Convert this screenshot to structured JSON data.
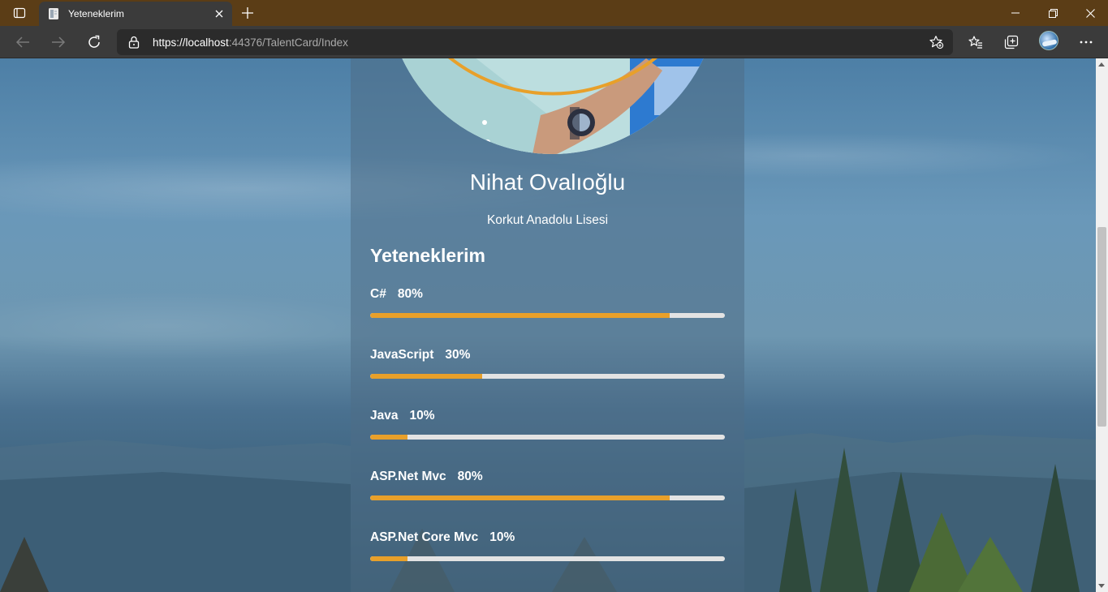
{
  "browser": {
    "tab_title": "Yeteneklerim",
    "url_host": "https://localhost",
    "url_rest": ":44376/TalentCard/Index",
    "icons": [
      "tab-actions-icon",
      "page-favicon-icon",
      "close-icon",
      "plus-icon",
      "minimize-icon",
      "restore-icon",
      "close-window-icon",
      "back-icon",
      "forward-icon",
      "refresh-icon",
      "lock-icon",
      "add-favorite-icon",
      "favorites-icon",
      "collections-icon",
      "profile-avatar",
      "more-icon"
    ]
  },
  "profile": {
    "name": "Nihat Ovalıoğlu",
    "school": "Korkut Anadolu Lisesi"
  },
  "skills": {
    "title": "Yeteneklerim",
    "items": [
      {
        "name": "C#",
        "percent_label": "80%",
        "level": 0.8
      },
      {
        "name": "JavaScript",
        "percent_label": "30%",
        "level": 0.3
      },
      {
        "name": "Java",
        "percent_label": "10%",
        "level": 0.1
      },
      {
        "name": "ASP.Net Mvc",
        "percent_label": "80%",
        "level": 0.8
      },
      {
        "name": "ASP.Net Core Mvc",
        "percent_label": "10%",
        "level": 0.1
      }
    ]
  },
  "colors": {
    "accent": "#e8a02a",
    "titlebar": "#5b3d16",
    "toolbar": "#3b3b3b",
    "track": "#e3e3e3"
  }
}
